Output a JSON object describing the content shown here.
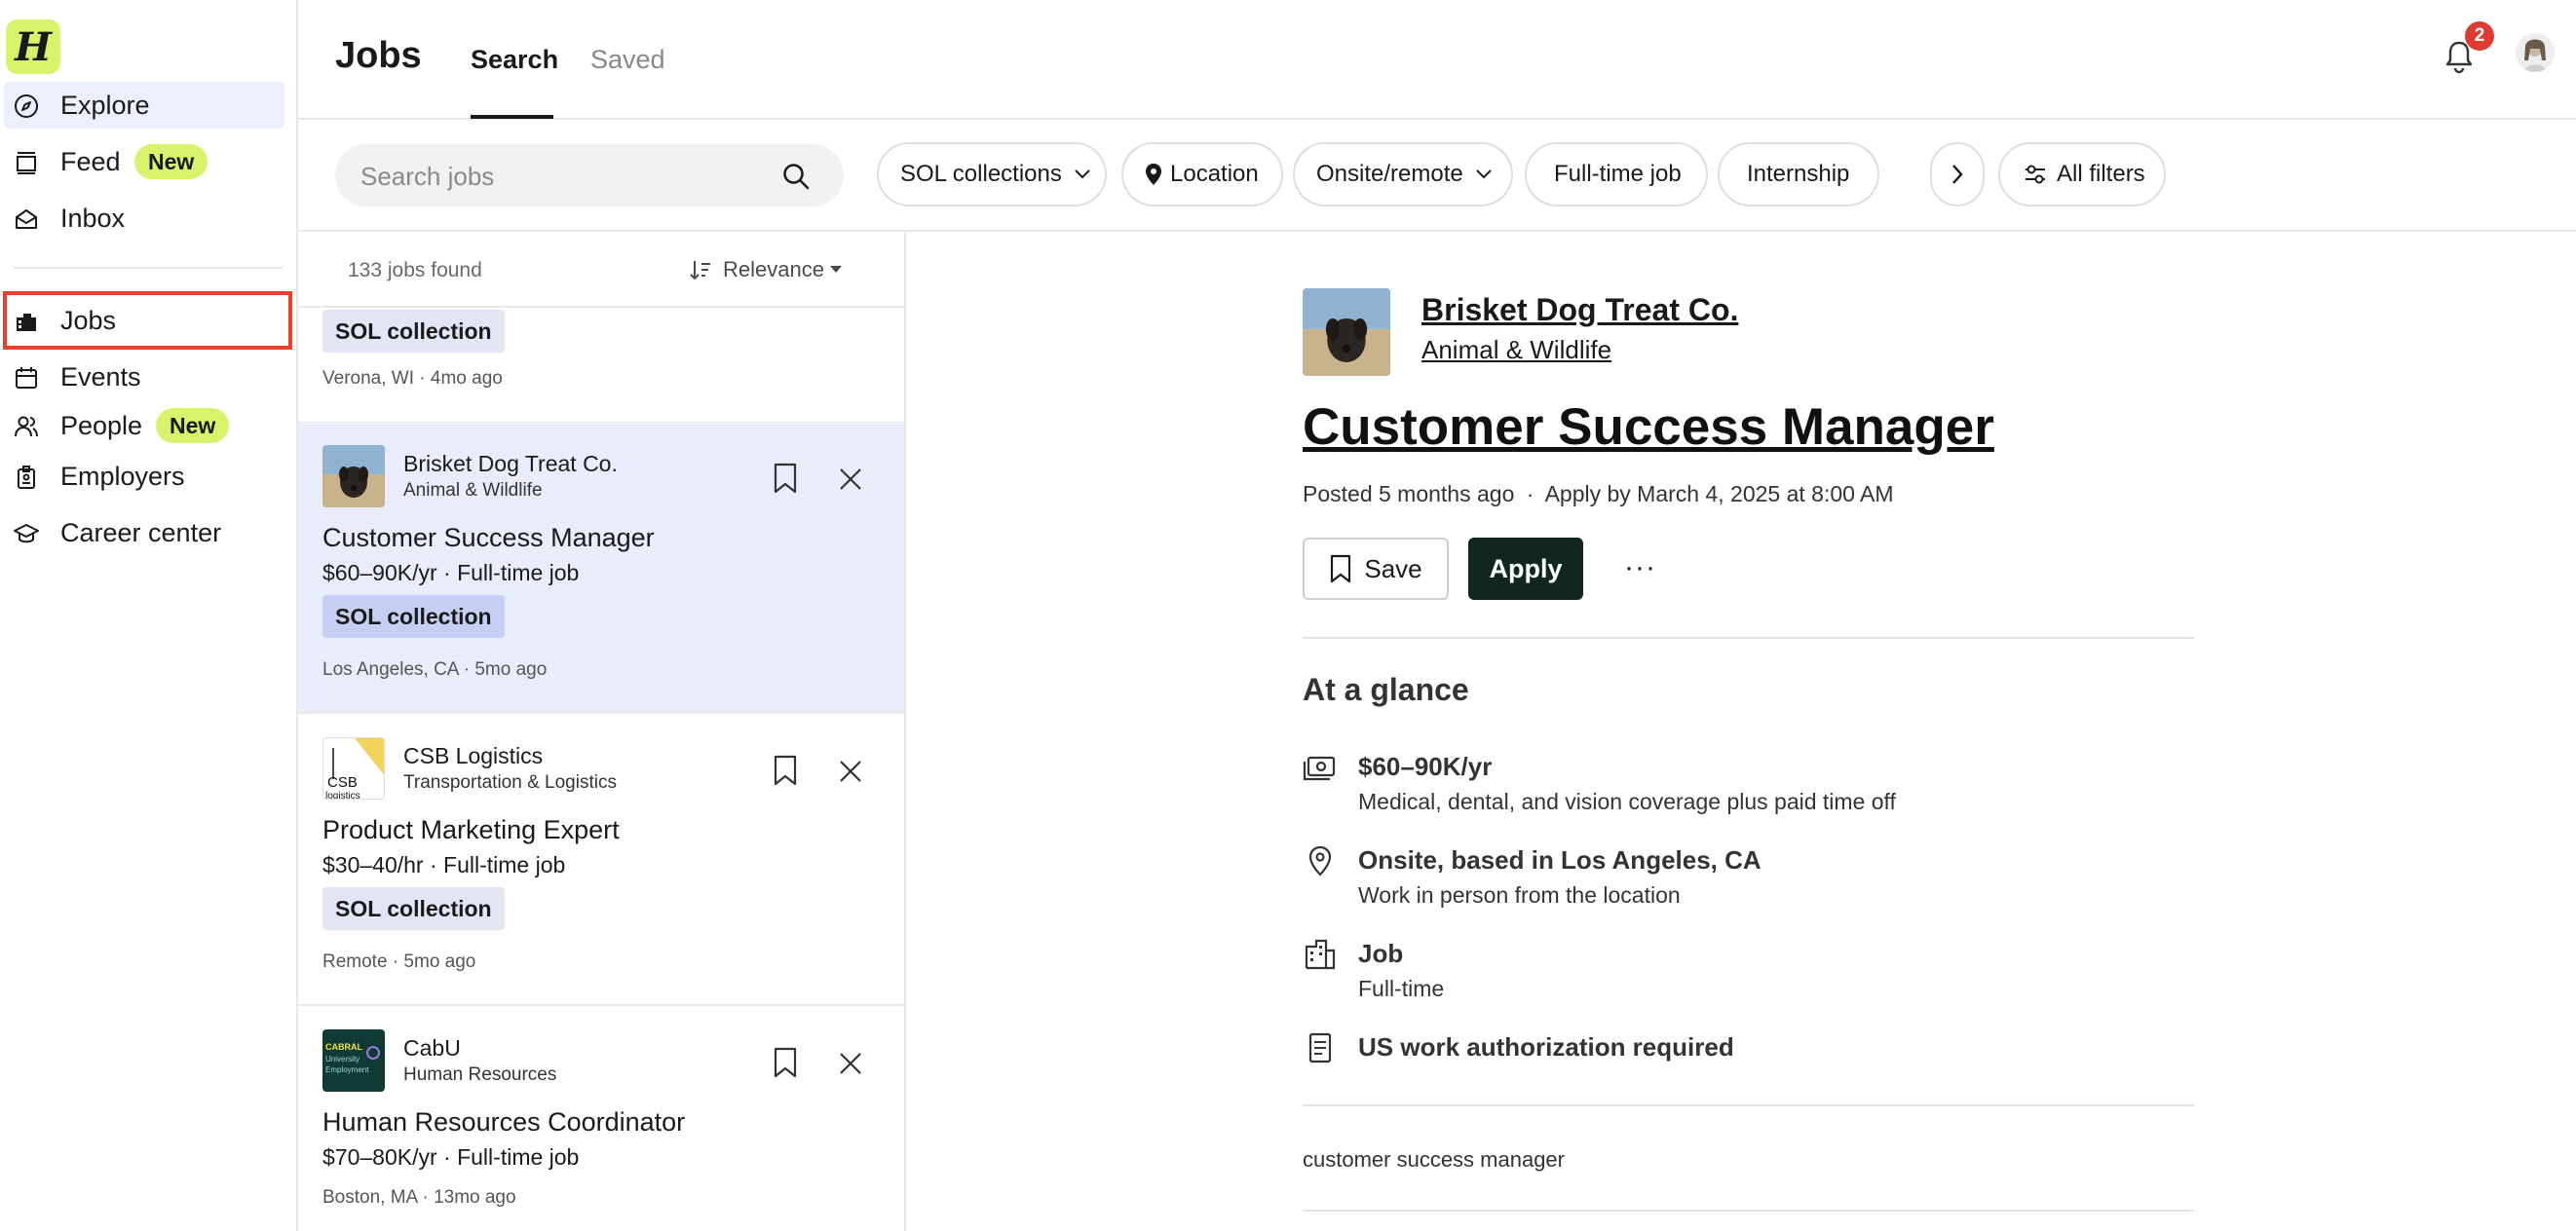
{
  "sidebar": {
    "logo_letter": "H",
    "items": [
      {
        "label": "Explore",
        "icon": "compass-icon"
      },
      {
        "label": "Feed",
        "icon": "feed-icon",
        "badge": "New"
      },
      {
        "label": "Inbox",
        "icon": "inbox-icon"
      },
      {
        "label": "Jobs",
        "icon": "briefcase-icon"
      },
      {
        "label": "Events",
        "icon": "calendar-icon"
      },
      {
        "label": "People",
        "icon": "people-icon",
        "badge": "New"
      },
      {
        "label": "Employers",
        "icon": "building-badge-icon"
      },
      {
        "label": "Career center",
        "icon": "graduation-cap-icon"
      }
    ]
  },
  "header": {
    "title": "Jobs",
    "tabs": [
      {
        "label": "Search",
        "active": true
      },
      {
        "label": "Saved",
        "active": false
      }
    ],
    "notifications_count": "2"
  },
  "filters": {
    "search_placeholder": "Search jobs",
    "chips": [
      {
        "label": "SOL collections"
      },
      {
        "label": "Location"
      },
      {
        "label": "Onsite/remote"
      },
      {
        "label": "Full-time job"
      },
      {
        "label": "Internship"
      }
    ],
    "all_filters": "All filters"
  },
  "list": {
    "count": "133 jobs found",
    "sort": "Relevance",
    "cards": [
      {
        "tag": "SOL collection",
        "location": "Verona, WI",
        "age": "4mo ago"
      },
      {
        "company": "Brisket Dog Treat Co.",
        "industry": "Animal & Wildlife",
        "title": "Customer Success Manager",
        "pay": "$60–90K/yr",
        "type": "Full-time job",
        "tag": "SOL collection",
        "location": "Los Angeles, CA",
        "age": "5mo ago"
      },
      {
        "company": "CSB Logistics",
        "industry": "Transportation & Logistics",
        "title": "Product Marketing Expert",
        "pay": "$30–40/hr",
        "type": "Full-time job",
        "tag": "SOL collection",
        "location": "Remote",
        "age": "5mo ago",
        "logo_text": [
          "CSB",
          "logistics"
        ]
      },
      {
        "company": "CabU",
        "industry": "Human Resources",
        "title": "Human Resources Coordinator",
        "pay": "$70–80K/yr",
        "type": "Full-time job",
        "location": "Boston, MA",
        "age": "13mo ago",
        "logo_text": [
          "CABRAL",
          "University",
          "Employment"
        ]
      }
    ]
  },
  "detail": {
    "company": "Brisket Dog Treat Co.",
    "industry": "Animal & Wildlife",
    "title": "Customer Success Manager",
    "posted": "Posted 5 months ago",
    "apply_by": "Apply by March 4, 2025 at 8:00 AM",
    "save_label": "Save",
    "apply_label": "Apply",
    "more_label": "···",
    "glance_heading": "At a glance",
    "glance": [
      {
        "icon": "money-icon",
        "title": "$60–90K/yr",
        "sub": "Medical, dental, and vision coverage plus paid time off"
      },
      {
        "icon": "location-pin-icon",
        "title": "Onsite, based in Los Angeles, CA",
        "sub": "Work in person from the location"
      },
      {
        "icon": "building-icon",
        "title": "Job",
        "sub": "Full-time"
      },
      {
        "icon": "document-icon",
        "title": "US work authorization required",
        "sub": ""
      }
    ],
    "keywords": "customer success manager"
  },
  "colors": {
    "brand_lime": "#d7f36b",
    "selected_bg": "#e9edfb",
    "apply_bg": "#10261f",
    "badge_red": "#dc3b32",
    "highlight_red": "#e8422f"
  }
}
